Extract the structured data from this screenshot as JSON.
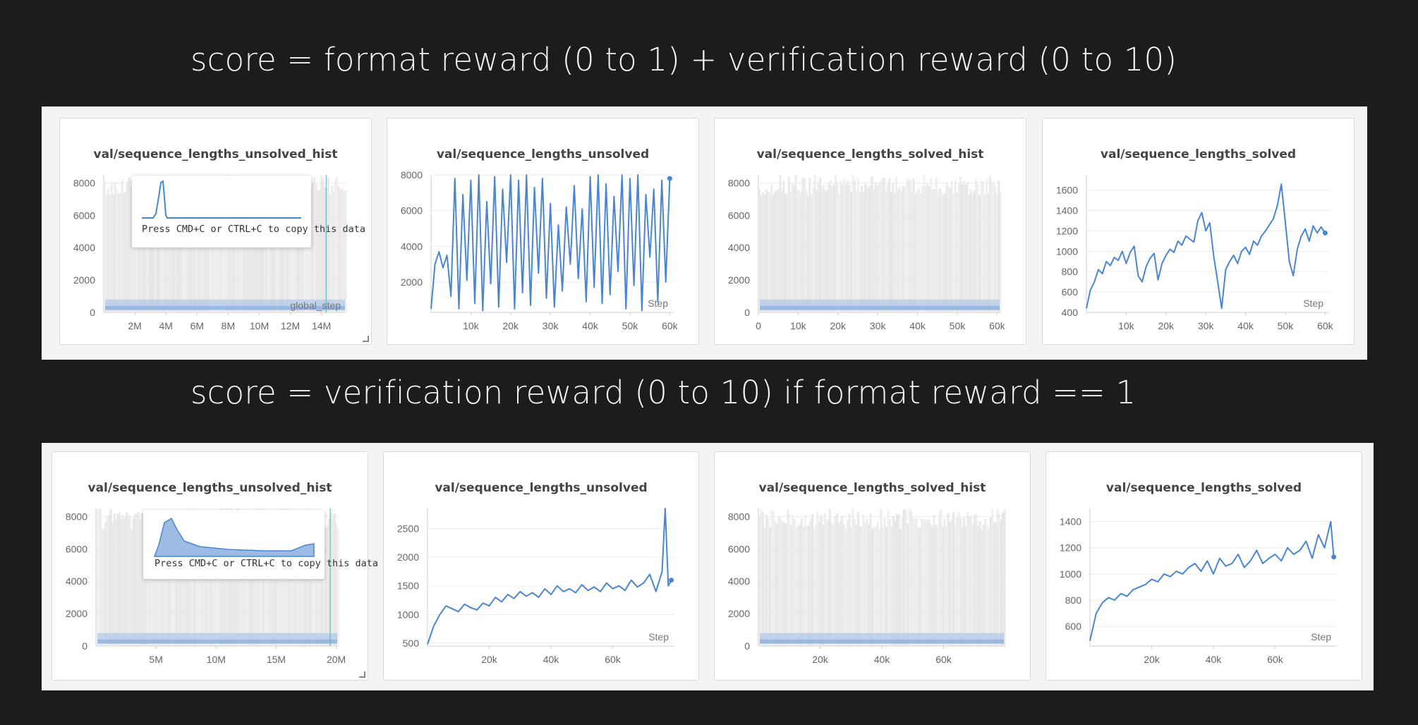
{
  "headings": {
    "top": "score = format reward (0 to 1) + verification reward (0 to 10)",
    "bottom": "score = verification reward (0 to 10) if format reward == 1"
  },
  "colors": {
    "line": "#4a86d0",
    "hist_bg": "#e6e6e6",
    "grid": "#ededed",
    "cursor": "#4fb3b3"
  },
  "tooltip_text": "Press CMD+C or CTRL+C to copy this data",
  "overlay_label": "global_step",
  "step_label": "Step",
  "chart_data": [
    {
      "id": "r1c1",
      "title": "val/sequence_lengths_unsolved_hist",
      "type": "heatmap",
      "ylim": [
        0,
        8500
      ],
      "yticks": [
        0,
        2000,
        4000,
        6000,
        8000
      ],
      "xlim": [
        0,
        15600000
      ],
      "xticks": [
        2000000,
        4000000,
        6000000,
        8000000,
        10000000,
        12000000,
        14000000
      ],
      "xtick_labels": [
        "2M",
        "4M",
        "6M",
        "8M",
        "10M",
        "12M",
        "14M"
      ],
      "tooltip": true,
      "cursor_x": 14300000,
      "x_label_overlay": "global_step"
    },
    {
      "id": "r1c2",
      "title": "val/sequence_lengths_unsolved",
      "type": "line",
      "ylim": [
        300,
        8000
      ],
      "yticks": [
        2000,
        4000,
        6000,
        8000
      ],
      "xlim": [
        0,
        61000
      ],
      "xticks": [
        10000,
        20000,
        30000,
        40000,
        50000,
        60000
      ],
      "xtick_labels": [
        "10k",
        "20k",
        "30k",
        "40k",
        "50k",
        "60k"
      ],
      "xlabel": "Step",
      "series": [
        {
          "x": [
            0,
            1000,
            2000,
            3000,
            4000,
            5000,
            6000,
            7000,
            8000,
            9000,
            10000,
            11000,
            12000,
            13000,
            14000,
            15000,
            16000,
            17000,
            18000,
            19000,
            20000,
            21000,
            22000,
            23000,
            24000,
            25000,
            26000,
            27000,
            28000,
            29000,
            30000,
            31000,
            32000,
            33000,
            34000,
            35000,
            36000,
            37000,
            38000,
            39000,
            40000,
            41000,
            42000,
            43000,
            44000,
            45000,
            46000,
            47000,
            48000,
            49000,
            50000,
            51000,
            52000,
            53000,
            54000,
            55000,
            56000,
            57000,
            58000,
            59000,
            60000
          ],
          "y": [
            500,
            3000,
            3700,
            2800,
            3500,
            1200,
            7800,
            500,
            6900,
            2100,
            7700,
            800,
            8000,
            400,
            6500,
            1900,
            7900,
            600,
            7200,
            3100,
            8000,
            500,
            7700,
            1400,
            8000,
            700,
            7300,
            2500,
            7800,
            1100,
            6400,
            600,
            5200,
            1500,
            6200,
            3000,
            7400,
            2200,
            6100,
            900,
            7900,
            1700,
            8000,
            800,
            7500,
            1300,
            6800,
            2600,
            8000,
            500,
            7800,
            1800,
            8000,
            400,
            6900,
            3400,
            7200,
            900,
            7700,
            2000,
            7800
          ]
        }
      ]
    },
    {
      "id": "r1c3",
      "title": "val/sequence_lengths_solved_hist",
      "type": "heatmap",
      "ylim": [
        0,
        8500
      ],
      "yticks": [
        0,
        2000,
        4000,
        6000,
        8000
      ],
      "xlim": [
        0,
        61000
      ],
      "xticks": [
        0,
        10000,
        20000,
        30000,
        40000,
        50000,
        60000
      ],
      "xtick_labels": [
        "0",
        "10k",
        "20k",
        "30k",
        "40k",
        "50k",
        "60k"
      ]
    },
    {
      "id": "r1c4",
      "title": "val/sequence_lengths_solved",
      "type": "line",
      "ylim": [
        400,
        1750
      ],
      "yticks": [
        400,
        600,
        800,
        1000,
        1200,
        1400,
        1600
      ],
      "xlim": [
        0,
        61000
      ],
      "xticks": [
        10000,
        20000,
        30000,
        40000,
        50000,
        60000
      ],
      "xtick_labels": [
        "10k",
        "20k",
        "30k",
        "40k",
        "50k",
        "60k"
      ],
      "xlabel": "Step",
      "series": [
        {
          "x": [
            0,
            1000,
            2000,
            3000,
            4000,
            5000,
            6000,
            7000,
            8000,
            9000,
            10000,
            11000,
            12000,
            13000,
            14000,
            15000,
            16000,
            17000,
            18000,
            19000,
            20000,
            21000,
            22000,
            23000,
            24000,
            25000,
            26000,
            27000,
            28000,
            29000,
            30000,
            31000,
            32000,
            33000,
            34000,
            35000,
            36000,
            37000,
            38000,
            39000,
            40000,
            41000,
            42000,
            43000,
            44000,
            45000,
            46000,
            47000,
            48000,
            49000,
            50000,
            51000,
            52000,
            53000,
            54000,
            55000,
            56000,
            57000,
            58000,
            59000,
            60000
          ],
          "y": [
            440,
            620,
            700,
            820,
            780,
            900,
            860,
            940,
            910,
            1000,
            880,
            990,
            1050,
            760,
            700,
            850,
            930,
            980,
            720,
            880,
            960,
            1020,
            990,
            1100,
            1060,
            1150,
            1120,
            1090,
            1300,
            1380,
            1200,
            1280,
            950,
            700,
            440,
            820,
            900,
            960,
            880,
            1000,
            1040,
            970,
            1100,
            1060,
            1150,
            1200,
            1260,
            1320,
            1450,
            1660,
            1280,
            900,
            760,
            1020,
            1150,
            1220,
            1100,
            1250,
            1180,
            1240,
            1180
          ]
        }
      ]
    },
    {
      "id": "r2c1",
      "title": "val/sequence_lengths_unsolved_hist",
      "type": "heatmap",
      "ylim": [
        0,
        8500
      ],
      "yticks": [
        0,
        2000,
        4000,
        6000,
        8000
      ],
      "xlim": [
        0,
        20200000
      ],
      "xticks": [
        5000000,
        10000000,
        15000000,
        20000000
      ],
      "xtick_labels": [
        "5M",
        "10M",
        "15M",
        "20M"
      ],
      "tooltip": true,
      "cursor_x": 19500000
    },
    {
      "id": "r2c2",
      "title": "val/sequence_lengths_unsolved",
      "type": "line",
      "ylim": [
        450,
        2850
      ],
      "yticks": [
        500,
        1000,
        1500,
        2000,
        2500
      ],
      "xlim": [
        0,
        80000
      ],
      "xticks": [
        20000,
        40000,
        60000
      ],
      "xtick_labels": [
        "20k",
        "40k",
        "60k"
      ],
      "xlabel": "Step",
      "series": [
        {
          "x": [
            0,
            2000,
            4000,
            6000,
            8000,
            10000,
            12000,
            14000,
            16000,
            18000,
            20000,
            22000,
            24000,
            26000,
            28000,
            30000,
            32000,
            34000,
            36000,
            38000,
            40000,
            42000,
            44000,
            46000,
            48000,
            50000,
            52000,
            54000,
            56000,
            58000,
            60000,
            62000,
            64000,
            66000,
            68000,
            70000,
            72000,
            74000,
            76000,
            77000,
            78000,
            79000
          ],
          "y": [
            480,
            800,
            1000,
            1150,
            1100,
            1050,
            1180,
            1120,
            1080,
            1200,
            1150,
            1300,
            1220,
            1350,
            1280,
            1400,
            1320,
            1380,
            1300,
            1450,
            1350,
            1500,
            1400,
            1450,
            1380,
            1520,
            1420,
            1480,
            1400,
            1550,
            1450,
            1500,
            1420,
            1600,
            1480,
            1550,
            1700,
            1400,
            1750,
            2850,
            1500,
            1600
          ]
        }
      ]
    },
    {
      "id": "r2c3",
      "title": "val/sequence_lengths_solved_hist",
      "type": "heatmap",
      "ylim": [
        0,
        8500
      ],
      "yticks": [
        0,
        2000,
        4000,
        6000,
        8000
      ],
      "xlim": [
        0,
        80000
      ],
      "xticks": [
        20000,
        40000,
        60000
      ],
      "xtick_labels": [
        "20k",
        "40k",
        "60k"
      ]
    },
    {
      "id": "r2c4",
      "title": "val/sequence_lengths_solved",
      "type": "line",
      "ylim": [
        450,
        1500
      ],
      "yticks": [
        600,
        800,
        1000,
        1200,
        1400
      ],
      "xlim": [
        0,
        80000
      ],
      "xticks": [
        20000,
        40000,
        60000
      ],
      "xtick_labels": [
        "20k",
        "40k",
        "60k"
      ],
      "xlabel": "Step",
      "series": [
        {
          "x": [
            0,
            2000,
            4000,
            6000,
            8000,
            10000,
            12000,
            14000,
            16000,
            18000,
            20000,
            22000,
            24000,
            26000,
            28000,
            30000,
            32000,
            34000,
            36000,
            38000,
            40000,
            42000,
            44000,
            46000,
            48000,
            50000,
            52000,
            54000,
            56000,
            58000,
            60000,
            62000,
            64000,
            66000,
            68000,
            70000,
            72000,
            74000,
            76000,
            78000,
            79000
          ],
          "y": [
            490,
            700,
            780,
            820,
            800,
            850,
            830,
            880,
            900,
            920,
            960,
            940,
            1000,
            980,
            1020,
            1000,
            1050,
            1080,
            1020,
            1100,
            1000,
            1120,
            1060,
            1080,
            1150,
            1050,
            1100,
            1180,
            1080,
            1120,
            1150,
            1100,
            1200,
            1150,
            1180,
            1250,
            1120,
            1300,
            1200,
            1400,
            1130
          ]
        }
      ]
    }
  ]
}
